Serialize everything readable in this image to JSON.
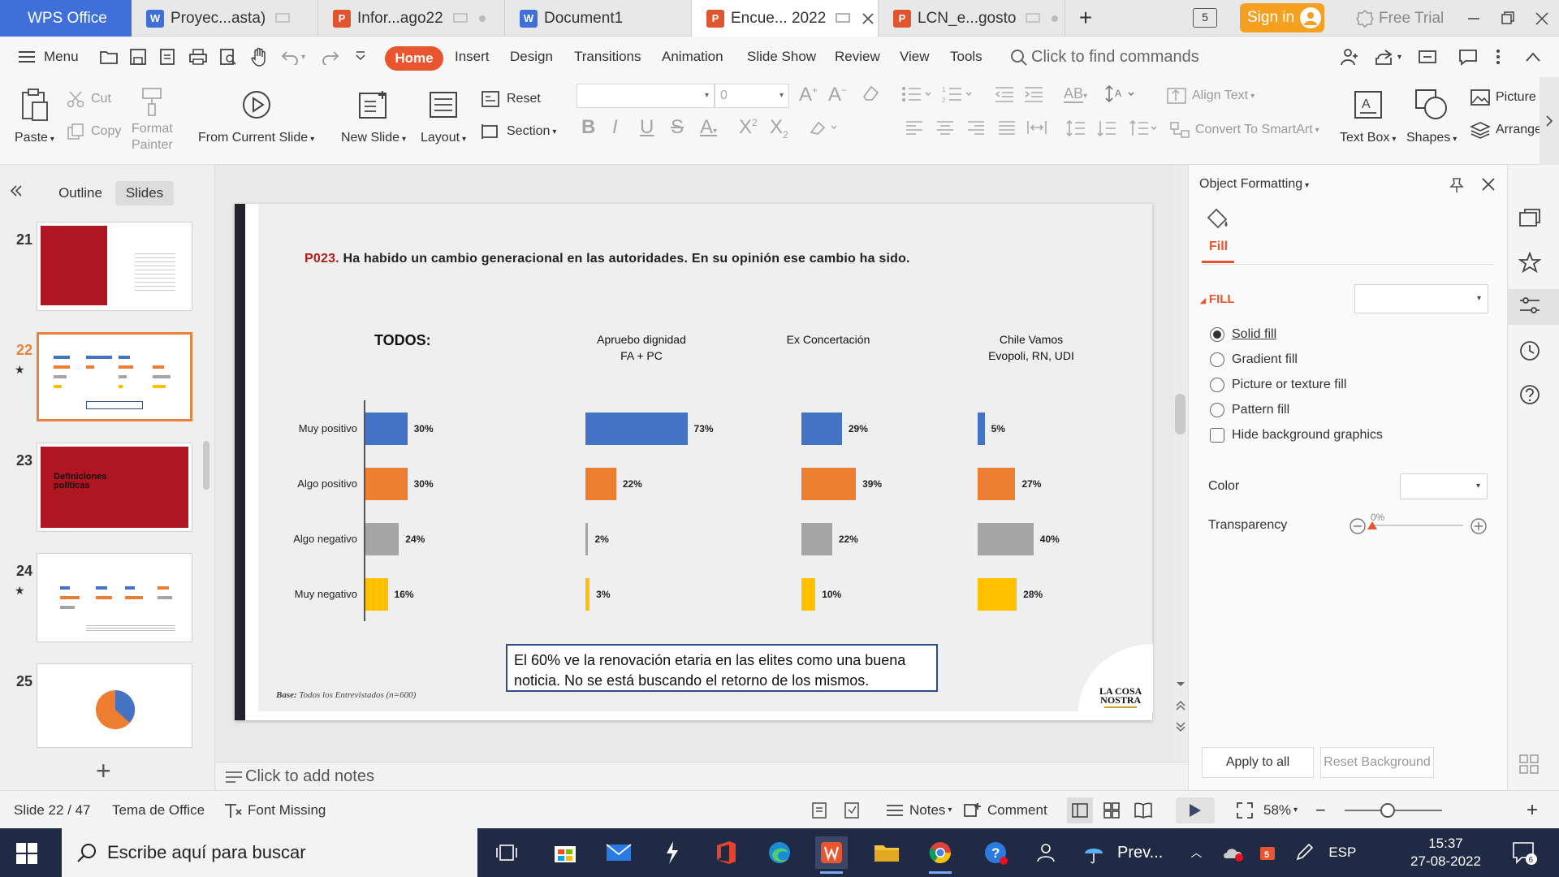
{
  "tabs": {
    "app": "WPS Office",
    "docs": [
      {
        "label": "Proyec...asta)",
        "type": "W"
      },
      {
        "label": "Infor...ago22",
        "type": "P"
      },
      {
        "label": "Document1",
        "type": "W"
      },
      {
        "label": "Encue... 2022",
        "type": "P",
        "active": true
      },
      {
        "label": "LCN_e...gosto",
        "type": "P"
      }
    ],
    "page_count": "5",
    "signin": "Sign in",
    "free_trial": "Free Trial"
  },
  "menu": {
    "menu_label": "Menu",
    "items": [
      "Home",
      "Insert",
      "Design",
      "Transitions",
      "Animation",
      "Slide Show",
      "Review",
      "View",
      "Tools"
    ],
    "search_placeholder": "Click to find commands"
  },
  "ribbon": {
    "paste": "Paste",
    "cut": "Cut",
    "copy": "Copy",
    "format_painter_1": "Format",
    "format_painter_2": "Painter",
    "from_current_slide": "From Current Slide",
    "new_slide": "New Slide",
    "layout": "Layout",
    "reset": "Reset",
    "section": "Section",
    "font_size": "0",
    "align_text": "Align Text",
    "convert_smartart": "Convert To SmartArt",
    "text_box": "Text Box",
    "shapes": "Shapes",
    "picture": "Picture",
    "arrange": "Arrange"
  },
  "left_panel": {
    "tabs": [
      "Outline",
      "Slides"
    ],
    "slides": [
      {
        "num": "21",
        "starred": false
      },
      {
        "num": "22",
        "starred": true,
        "selected": true
      },
      {
        "num": "23",
        "starred": false,
        "title": "Definiciones políticas"
      },
      {
        "num": "24",
        "starred": true
      },
      {
        "num": "25",
        "starred": false
      }
    ]
  },
  "slide": {
    "question_code": "P023.",
    "question_text": " Ha habido un cambio generacional en las autoridades. En su opinión ese cambio ha sido.",
    "todos_label": "TODOS:",
    "segments": [
      {
        "line1": "Apruebo dignidad",
        "line2": "FA + PC"
      },
      {
        "line1": "Ex Concertación",
        "line2": ""
      },
      {
        "line1": "Chile Vamos",
        "line2": "Evopoli, RN, UDI"
      }
    ],
    "callout": "El 60% ve la renovación etaria en las elites como una buena noticia. No se está buscando el retorno de los mismos.",
    "base_label": "Base:",
    "base_text": " Todos los Entrevistados (n=600)",
    "logo_line1": "LA COSA",
    "logo_line2": "NOSTRA"
  },
  "chart_data": {
    "type": "bar",
    "orientation": "horizontal",
    "categories": [
      "Muy positivo",
      "Algo positivo",
      "Algo negativo",
      "Muy negativo"
    ],
    "colors": [
      "#4472c4",
      "#ed7d31",
      "#a5a5a5",
      "#ffc000"
    ],
    "unit": "%",
    "series": [
      {
        "name": "TODOS",
        "values": [
          30,
          30,
          24,
          16
        ]
      },
      {
        "name": "Apruebo dignidad FA + PC",
        "values": [
          73,
          22,
          2,
          3
        ]
      },
      {
        "name": "Ex Concertación",
        "values": [
          29,
          39,
          22,
          10
        ]
      },
      {
        "name": "Chile Vamos Evopoli, RN, UDI",
        "values": [
          5,
          27,
          40,
          28
        ]
      }
    ]
  },
  "notes": {
    "placeholder": "Click to add notes"
  },
  "right_panel": {
    "title": "Object Formatting",
    "fill_tab": "Fill",
    "section": "FILL",
    "options": [
      "Solid fill",
      "Gradient fill",
      "Picture or texture fill",
      "Pattern fill"
    ],
    "selected_option": "Solid fill",
    "hide_bg": "Hide background graphics",
    "color_label": "Color",
    "transparency_label": "Transparency",
    "transparency_value": "0%",
    "apply_all": "Apply to all",
    "reset_bg": "Reset Background"
  },
  "status": {
    "slide_info": "Slide 22 / 47",
    "theme": "Tema de Office",
    "font_missing": "Font Missing",
    "notes": "Notes",
    "comment": "Comment",
    "zoom": "58%"
  },
  "taskbar": {
    "search_placeholder": "Escribe aquí para buscar",
    "weather": "Prev...",
    "lang": "ESP",
    "time": "15:37",
    "date": "27-08-2022",
    "notif_count": "6"
  }
}
